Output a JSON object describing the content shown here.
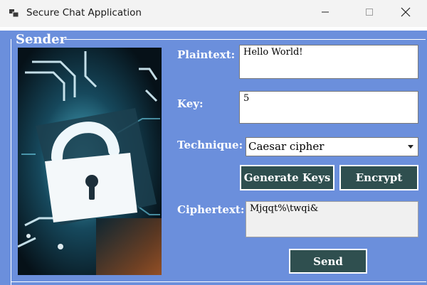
{
  "window": {
    "title": "Secure Chat Application",
    "icons": {
      "app": "app-icon",
      "minimize": "minimize-icon",
      "maximize": "maximize-icon",
      "close": "close-icon"
    }
  },
  "sender": {
    "group_label": "Sender",
    "image": "padlock-circuit-image",
    "plaintext": {
      "label": "Plaintext:",
      "value": "Hello World!"
    },
    "key": {
      "label": "Key:",
      "value": "5"
    },
    "technique": {
      "label": "Technique:",
      "selected": "Caesar cipher"
    },
    "buttons": {
      "generate_keys": "Generate Keys",
      "encrypt": "Encrypt",
      "send": "Send"
    },
    "ciphertext": {
      "label": "Ciphertext:",
      "value": "Mjqqt%\\twqi&"
    }
  },
  "colors": {
    "form_background": "#6b8fdc",
    "button_background": "#2f4f4f",
    "text_on_blue": "#ffffff"
  }
}
